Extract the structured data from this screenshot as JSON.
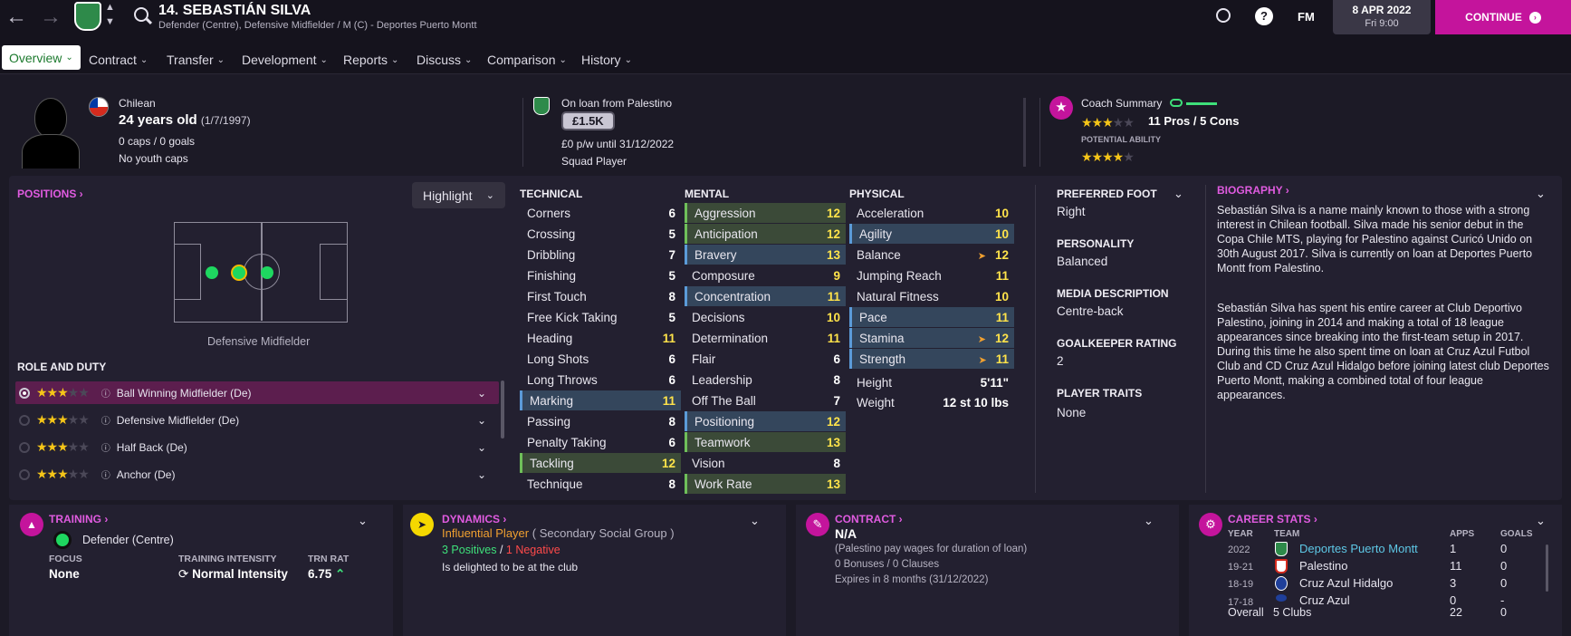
{
  "header": {
    "player_title": "14. SEBASTIÁN SILVA",
    "subtitle": "Defender (Centre), Defensive Midfielder / M (C) - Deportes Puerto Montt",
    "date": "8 APR 2022",
    "time": "Fri 9:00",
    "continue_label": "CONTINUE",
    "fm_label": "FM",
    "help_label": "?"
  },
  "tabs": [
    {
      "label": "Overview"
    },
    {
      "label": "Contract"
    },
    {
      "label": "Transfer"
    },
    {
      "label": "Development"
    },
    {
      "label": "Reports"
    },
    {
      "label": "Discuss"
    },
    {
      "label": "Comparison"
    },
    {
      "label": "History"
    }
  ],
  "profile": {
    "nationality": "Chilean",
    "age": "24 years old",
    "dob": "(1/7/1997)",
    "caps": "0 caps / 0 goals",
    "youth": "No youth caps"
  },
  "loan": {
    "title": "On loan from Palestino",
    "value": "£1.5K",
    "wage": "£0 p/w until 31/12/2022",
    "status": "Squad Player"
  },
  "coach": {
    "title": "Coach Summary",
    "pros_cons": "11 Pros / 5 Cons",
    "potential_label": "POTENTIAL ABILITY",
    "current_stars": 3,
    "potential_stars": 4
  },
  "positions": {
    "label": "POSITIONS",
    "highlight_label": "Highlight",
    "pitch_caption": "Defensive Midfielder"
  },
  "role": {
    "label": "ROLE AND DUTY",
    "items": [
      {
        "name": "Ball Winning Midfielder (De)",
        "stars": 3,
        "active": true
      },
      {
        "name": "Defensive Midfielder (De)",
        "stars": 3
      },
      {
        "name": "Half Back (De)",
        "stars": 3
      },
      {
        "name": "Anchor (De)",
        "stars": 3
      }
    ]
  },
  "technical": {
    "label": "TECHNICAL",
    "items": [
      {
        "name": "Corners",
        "value": "6"
      },
      {
        "name": "Crossing",
        "value": "5"
      },
      {
        "name": "Dribbling",
        "value": "7"
      },
      {
        "name": "Finishing",
        "value": "5"
      },
      {
        "name": "First Touch",
        "value": "8"
      },
      {
        "name": "Free Kick Taking",
        "value": "5"
      },
      {
        "name": "Heading",
        "value": "11"
      },
      {
        "name": "Long Shots",
        "value": "6"
      },
      {
        "name": "Long Throws",
        "value": "6"
      },
      {
        "name": "Marking",
        "value": "11"
      },
      {
        "name": "Passing",
        "value": "8"
      },
      {
        "name": "Penalty Taking",
        "value": "6"
      },
      {
        "name": "Tackling",
        "value": "12"
      },
      {
        "name": "Technique",
        "value": "8"
      }
    ]
  },
  "mental": {
    "label": "MENTAL",
    "items": [
      {
        "name": "Aggression",
        "value": "12"
      },
      {
        "name": "Anticipation",
        "value": "12"
      },
      {
        "name": "Bravery",
        "value": "13"
      },
      {
        "name": "Composure",
        "value": "9"
      },
      {
        "name": "Concentration",
        "value": "11"
      },
      {
        "name": "Decisions",
        "value": "10"
      },
      {
        "name": "Determination",
        "value": "11"
      },
      {
        "name": "Flair",
        "value": "6"
      },
      {
        "name": "Leadership",
        "value": "8"
      },
      {
        "name": "Off The Ball",
        "value": "7"
      },
      {
        "name": "Positioning",
        "value": "12"
      },
      {
        "name": "Teamwork",
        "value": "13"
      },
      {
        "name": "Vision",
        "value": "8"
      },
      {
        "name": "Work Rate",
        "value": "13"
      }
    ]
  },
  "physical": {
    "label": "PHYSICAL",
    "items": [
      {
        "name": "Acceleration",
        "value": "10"
      },
      {
        "name": "Agility",
        "value": "10"
      },
      {
        "name": "Balance",
        "value": "12"
      },
      {
        "name": "Jumping Reach",
        "value": "11"
      },
      {
        "name": "Natural Fitness",
        "value": "10"
      },
      {
        "name": "Pace",
        "value": "11"
      },
      {
        "name": "Stamina",
        "value": "12"
      },
      {
        "name": "Strength",
        "value": "11"
      }
    ],
    "height_label": "Height",
    "height": "5'11\"",
    "weight_label": "Weight",
    "weight": "12 st 10 lbs"
  },
  "info": {
    "foot_label": "PREFERRED FOOT",
    "foot": "Right",
    "personality_label": "PERSONALITY",
    "personality": "Balanced",
    "media_label": "MEDIA DESCRIPTION",
    "media": "Centre-back",
    "gk_label": "GOALKEEPER RATING",
    "gk": "2",
    "traits_label": "PLAYER TRAITS",
    "traits": "None"
  },
  "bio": {
    "label": "BIOGRAPHY",
    "p1": "Sebastián Silva is a name mainly known to those with a strong interest in Chilean football. Silva made his senior debut in the Copa Chile MTS, playing for Palestino against Curicó Unido on 30th August 2017. Silva is currently on loan at Deportes Puerto Montt from Palestino.",
    "p2": "Sebastián Silva has spent his entire career at Club Deportivo Palestino, joining in 2014 and making a total of 18 league appearances since breaking into the first-team setup in 2017. During this time he also spent time on loan at Cruz Azul Futbol Club and CD Cruz Azul Hidalgo before joining latest club Deportes Puerto Montt, making a combined total of four league appearances."
  },
  "training": {
    "label": "TRAINING",
    "role": "Defender (Centre)",
    "focus_label": "FOCUS",
    "focus": "None",
    "intensity_label": "TRAINING INTENSITY",
    "intensity": "Normal Intensity",
    "rat_label": "TRN RAT",
    "rat": "6.75"
  },
  "dynamics": {
    "label": "DYNAMICS",
    "influence": "Influential Player",
    "group": "( Secondary Social Group )",
    "positives": "3 Positives",
    "sep": "/",
    "negatives": "1 Negative",
    "status": "Is delighted to be at the club"
  },
  "contract": {
    "label": "CONTRACT",
    "value": "N/A",
    "note": "(Palestino pay wages for duration of loan)",
    "bonuses": "0 Bonuses / 0 Clauses",
    "expires": "Expires in 8 months  (31/12/2022)"
  },
  "career": {
    "label": "CAREER STATS",
    "headers": [
      "YEAR",
      "TEAM",
      "APPS",
      "GOALS"
    ],
    "rows": [
      {
        "year": "2022",
        "team": "Deportes Puerto Montt",
        "apps": "1",
        "goals": "0"
      },
      {
        "year": "19-21",
        "team": "Palestino",
        "apps": "11",
        "goals": "0"
      },
      {
        "year": "18-19",
        "team": "Cruz Azul Hidalgo",
        "apps": "3",
        "goals": "0"
      },
      {
        "year": "17-18",
        "team": "Cruz Azul",
        "apps": "0",
        "goals": "-"
      }
    ],
    "overall_label": "Overall",
    "overall_clubs": "5 Clubs",
    "overall_apps": "22",
    "overall_goals": "0"
  },
  "colors": {
    "accent": "#c4149c",
    "pink": "#e05be0",
    "yellow": "#ffe34a",
    "green": "#6fbf5a",
    "blue": "#5b9bd8"
  }
}
